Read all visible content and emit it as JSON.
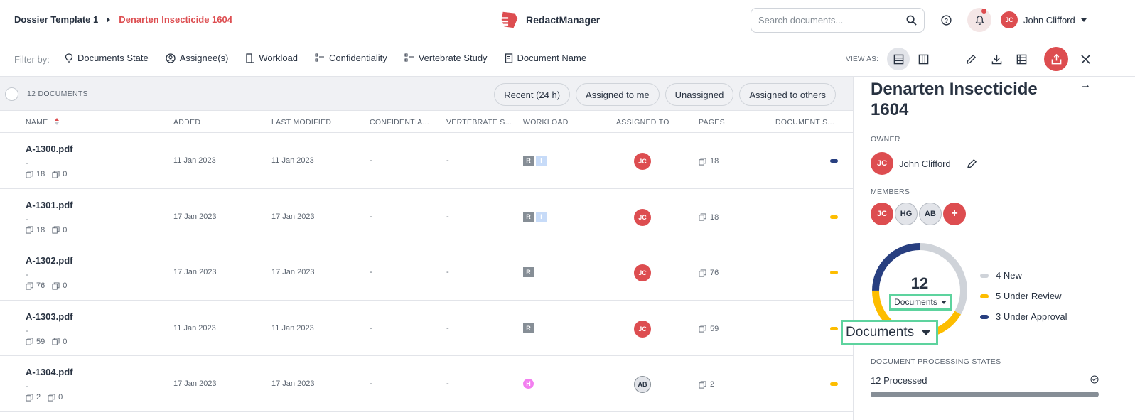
{
  "header": {
    "breadcrumb": [
      "Dossier Template 1",
      "Denarten Insecticide 1604"
    ],
    "app_name": "RedactManager",
    "search_placeholder": "Search documents...",
    "user_initials": "JC",
    "user_name": "John Clifford"
  },
  "filterbar": {
    "label": "Filter by:",
    "filters": [
      "Documents State",
      "Assignee(s)",
      "Workload",
      "Confidentiality",
      "Vertebrate Study",
      "Document Name"
    ],
    "view_as": "VIEW AS:"
  },
  "list": {
    "count": "12 DOCUMENTS",
    "quick_filters": [
      "Recent (24 h)",
      "Assigned to me",
      "Unassigned",
      "Assigned to others"
    ],
    "columns": [
      "NAME",
      "ADDED",
      "LAST MODIFIED",
      "CONFIDENTIA...",
      "VERTEBRATE S...",
      "WORKLOAD",
      "ASSIGNED TO",
      "PAGES",
      "DOCUMENT S..."
    ],
    "rows": [
      {
        "name": "A-1300.pdf",
        "sub": "-",
        "pages_count": "18",
        "excluded": "0",
        "added": "11 Jan 2023",
        "modified": "11 Jan 2023",
        "conf": "-",
        "vert": "-",
        "workload": [
          "R",
          "I"
        ],
        "assignee": "JC",
        "pages": "18",
        "status_color": "#283f80"
      },
      {
        "name": "A-1301.pdf",
        "sub": "-",
        "pages_count": "18",
        "excluded": "0",
        "added": "17 Jan 2023",
        "modified": "17 Jan 2023",
        "conf": "-",
        "vert": "-",
        "workload": [
          "R",
          "I"
        ],
        "assignee": "JC",
        "pages": "18",
        "status_color": "#fdbd00"
      },
      {
        "name": "A-1302.pdf",
        "sub": "-",
        "pages_count": "76",
        "excluded": "0",
        "added": "17 Jan 2023",
        "modified": "17 Jan 2023",
        "conf": "-",
        "vert": "-",
        "workload": [
          "R"
        ],
        "assignee": "JC",
        "pages": "76",
        "status_color": "#fdbd00"
      },
      {
        "name": "A-1303.pdf",
        "sub": "-",
        "pages_count": "59",
        "excluded": "0",
        "added": "11 Jan 2023",
        "modified": "11 Jan 2023",
        "conf": "-",
        "vert": "-",
        "workload": [
          "R"
        ],
        "assignee": "JC",
        "pages": "59",
        "status_color": "#fdbd00"
      },
      {
        "name": "A-1304.pdf",
        "sub": "-",
        "pages_count": "2",
        "excluded": "0",
        "added": "17 Jan 2023",
        "modified": "17 Jan 2023",
        "conf": "-",
        "vert": "-",
        "workload": [
          "H"
        ],
        "assignee": "AB",
        "pages": "2",
        "status_color": "#fdbd00"
      }
    ]
  },
  "panel": {
    "title": "Denarten Insecticide 1604",
    "owner_label": "OWNER",
    "owner_initials": "JC",
    "owner_name": "John Clifford",
    "members_label": "MEMBERS",
    "members": [
      "JC",
      "HG",
      "AB",
      "+"
    ],
    "total": "12",
    "dropdown": "Documents",
    "legend": [
      {
        "label": "4 New",
        "value": 4,
        "color": "#cfd3d9"
      },
      {
        "label": "5 Under Review",
        "value": 5,
        "color": "#fdbd00"
      },
      {
        "label": "3 Under Approval",
        "value": 3,
        "color": "#283f80"
      }
    ],
    "processing_label": "DOCUMENT PROCESSING STATES",
    "processed": "12 Processed",
    "processed_fraction": 1.0
  }
}
